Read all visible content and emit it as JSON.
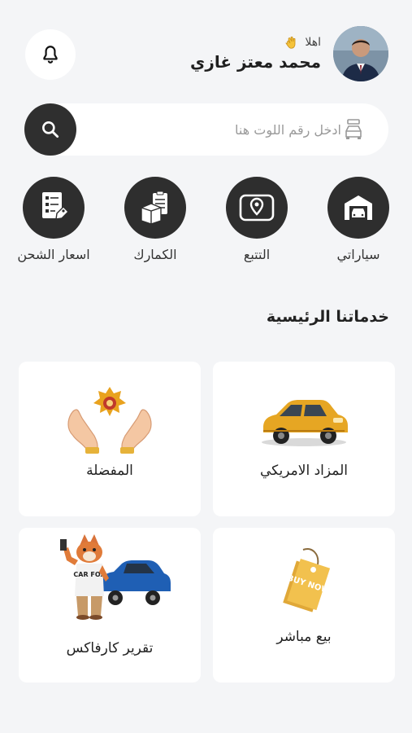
{
  "header": {
    "greeting": "اهلا",
    "user_name": "محمد معتز غازي"
  },
  "search": {
    "placeholder": "ادخل رقم اللوت هنا"
  },
  "quick_actions": [
    {
      "label": "سياراتي"
    },
    {
      "label": "التتبع"
    },
    {
      "label": "الكمارك"
    },
    {
      "label": "اسعار الشحن"
    }
  ],
  "section": {
    "title": "خدماتنا الرئيسية"
  },
  "services": [
    {
      "label": "المزاد الامريكي"
    },
    {
      "label": "المفضلة"
    },
    {
      "label": "بيع مباشر",
      "tag_text": "BUY NOW"
    },
    {
      "label": "تقرير كارفاكس",
      "mascot_shirt": "CAR FOX"
    }
  ],
  "colors": {
    "background": "#f4f5f7",
    "dark": "#2e2e2e",
    "car": "#e6a623",
    "tag": "#f2c14e"
  }
}
